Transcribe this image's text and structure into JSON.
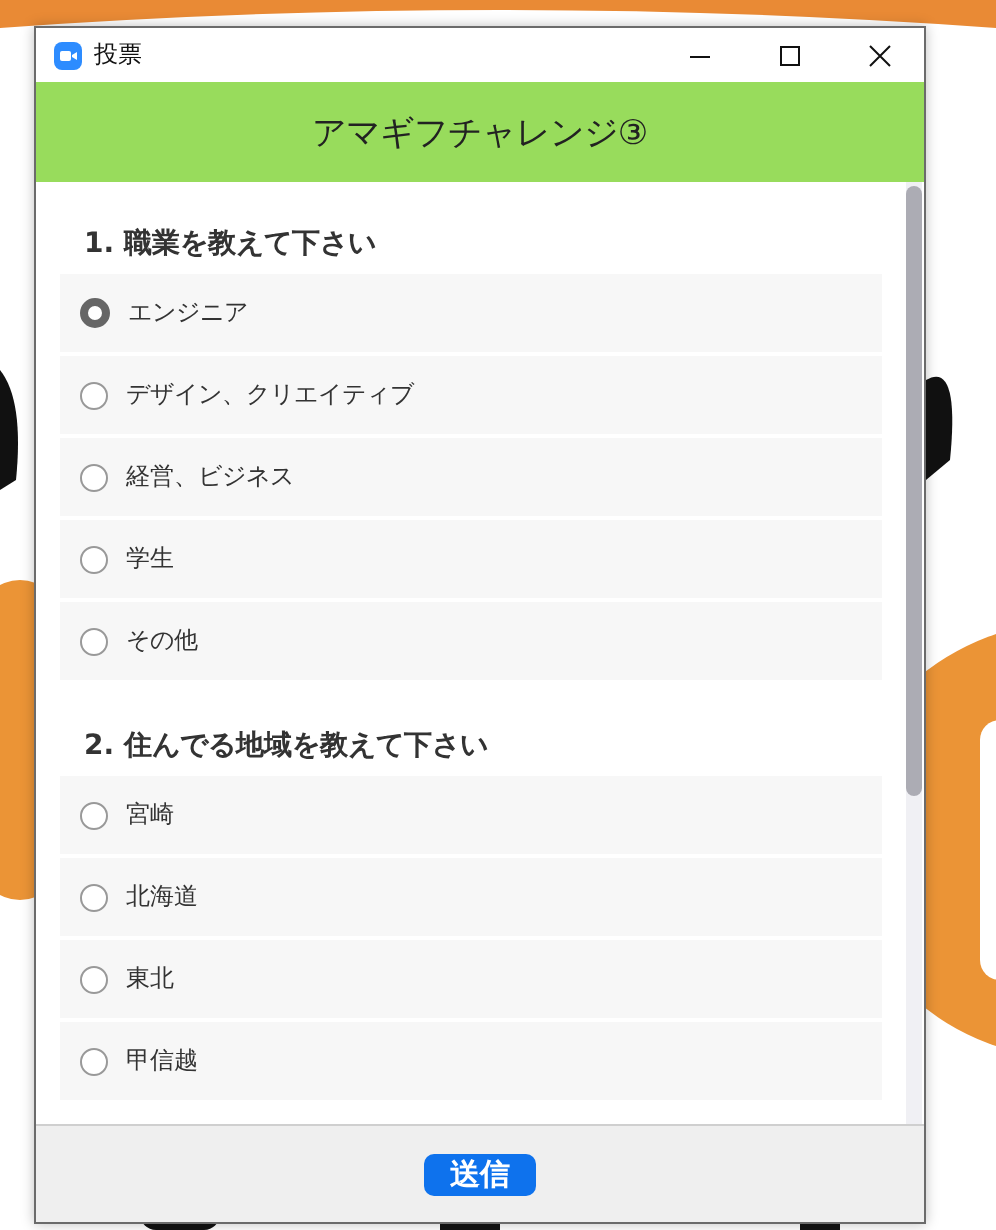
{
  "window": {
    "title": "投票"
  },
  "poll": {
    "title": "アマギフチャレンジ③",
    "questions": [
      {
        "heading": "1. 職業を教えて下さい",
        "options": [
          {
            "label": "エンジニア",
            "selected": true
          },
          {
            "label": "デザイン、クリエイティブ",
            "selected": false
          },
          {
            "label": "経営、ビジネス",
            "selected": false
          },
          {
            "label": "学生",
            "selected": false
          },
          {
            "label": "その他",
            "selected": false
          }
        ]
      },
      {
        "heading": "2. 住んでる地域を教えて下さい",
        "options": [
          {
            "label": "宮崎",
            "selected": false
          },
          {
            "label": "北海道",
            "selected": false
          },
          {
            "label": "東北",
            "selected": false
          },
          {
            "label": "甲信越",
            "selected": false
          }
        ]
      }
    ]
  },
  "submit": "送信"
}
